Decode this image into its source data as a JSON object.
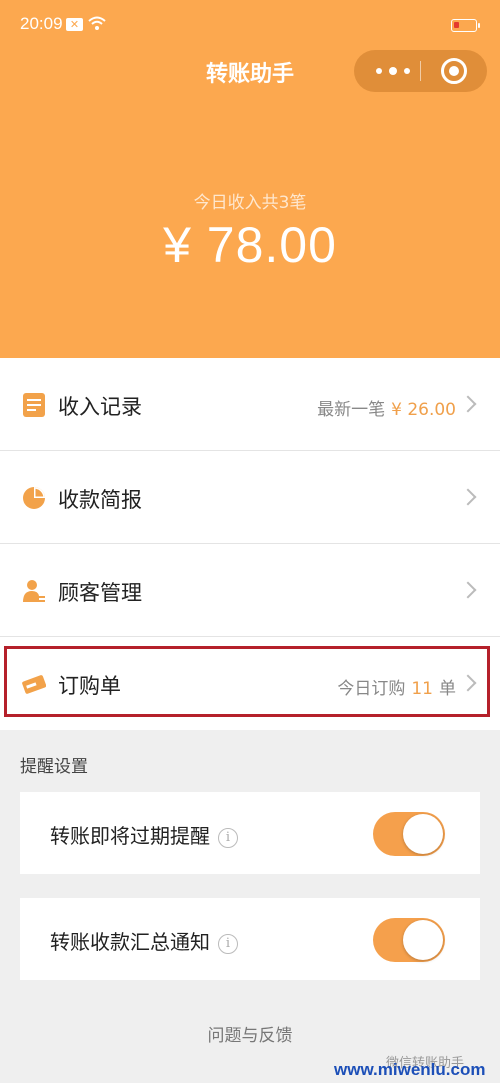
{
  "status_bar": {
    "time": "20:09",
    "notification_badge": "✕"
  },
  "nav": {
    "title": "转账助手",
    "more_icon": "more-dots-icon",
    "close_icon": "target-circle-icon"
  },
  "summary": {
    "caption": "今日收入共3笔",
    "amount": "¥ 78.00"
  },
  "menu": {
    "income_records": {
      "label": "收入记录",
      "right_prefix": "最新一笔",
      "right_value": "¥ 26.00"
    },
    "payment_report": {
      "label": "收款简报"
    },
    "customer_mgmt": {
      "label": "顾客管理"
    },
    "orders": {
      "label": "订购单",
      "right_prefix": "今日订购",
      "right_value": "11",
      "right_suffix": "单"
    }
  },
  "reminders": {
    "section_title": "提醒设置",
    "items": [
      {
        "label": "转账即将过期提醒",
        "enabled": true
      },
      {
        "label": "转账收款汇总通知",
        "enabled": true
      }
    ]
  },
  "footer": {
    "feedback": "问题与反馈"
  },
  "watermark": {
    "account": "微信转账助手",
    "site": "www.miwenlu.com"
  },
  "colors": {
    "brand": "#fca84f",
    "accent": "#f0a04b",
    "highlight_border": "#b5202a"
  }
}
